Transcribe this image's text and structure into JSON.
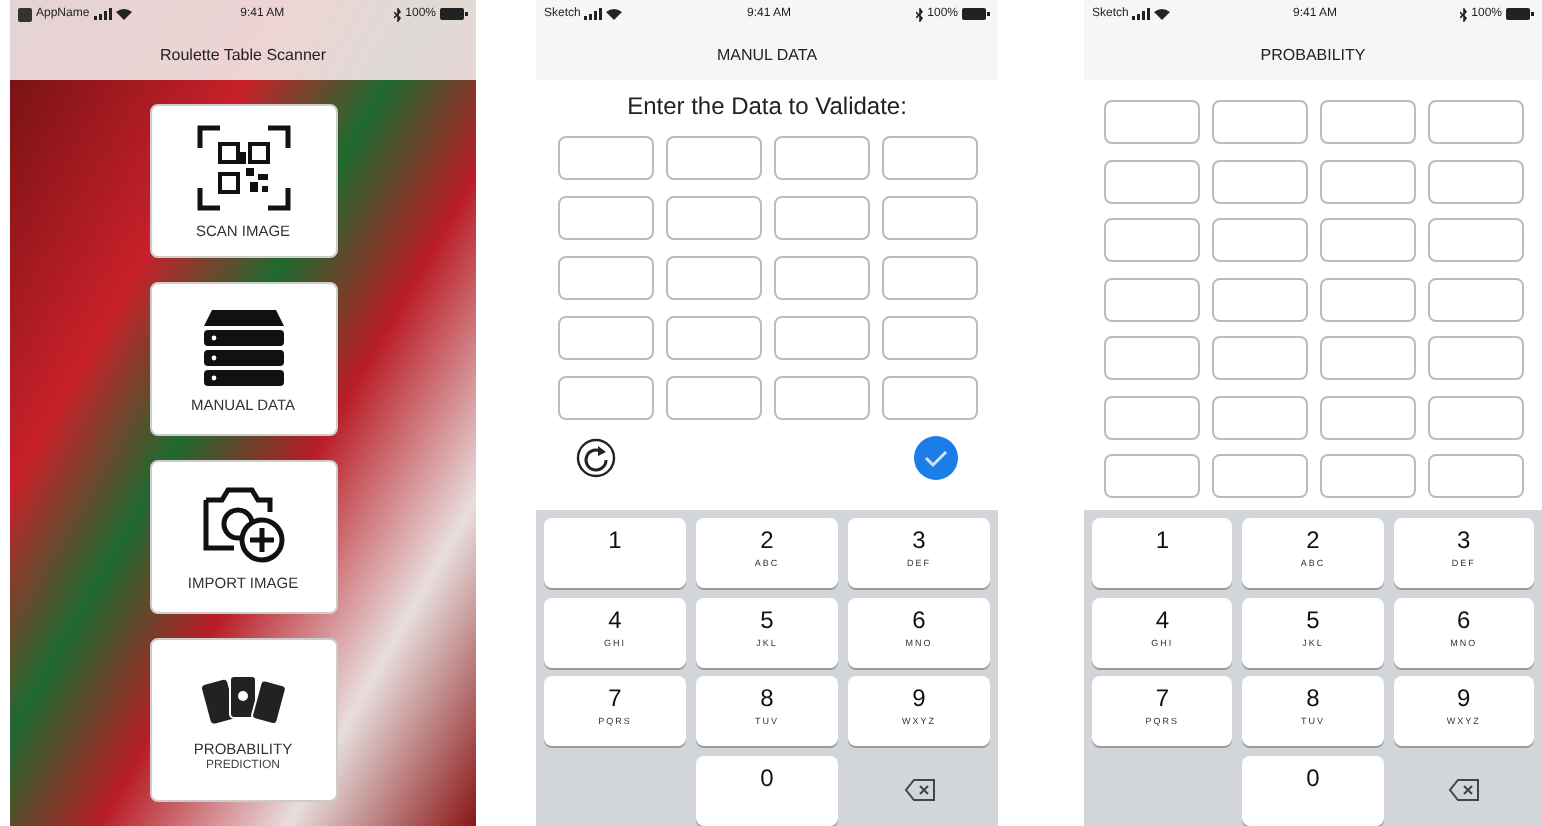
{
  "screens": [
    {
      "kind": "menu",
      "status": {
        "carrier": "AppName",
        "time": "9:41 AM",
        "battery": "100%"
      },
      "title": "Roulette Table Scanner",
      "buttons": [
        {
          "kind": "scan",
          "label": "SCAN IMAGE"
        },
        {
          "kind": "manual",
          "label": "MANUAL DATA"
        },
        {
          "kind": "import",
          "label": "IMPORT IMAGE"
        },
        {
          "kind": "cards",
          "label": "PROBABILITY",
          "sublabel": "PREDICTION"
        }
      ]
    },
    {
      "kind": "entry",
      "status": {
        "carrier": "Sketch",
        "time": "9:41 AM",
        "battery": "100%"
      },
      "title": "MANUL DATA",
      "heading": "Enter the Data to Validate:",
      "keys": [
        {
          "kind": "digit",
          "digit": "1"
        },
        {
          "kind": "digit",
          "digit": "2",
          "letters": "ABC"
        },
        {
          "kind": "digit",
          "digit": "3",
          "letters": "DEF"
        },
        {
          "kind": "digit",
          "digit": "4",
          "letters": "GHI"
        },
        {
          "kind": "digit",
          "digit": "5",
          "letters": "JKL"
        },
        {
          "kind": "digit",
          "digit": "6",
          "letters": "MNO"
        },
        {
          "kind": "digit",
          "digit": "7",
          "letters": "PQRS"
        },
        {
          "kind": "digit",
          "digit": "8",
          "letters": "TUV"
        },
        {
          "kind": "digit",
          "digit": "9",
          "letters": "WXYZ"
        },
        {
          "kind": "blank"
        },
        {
          "kind": "digit",
          "digit": "0"
        },
        {
          "kind": "delete"
        }
      ]
    },
    {
      "kind": "probability",
      "status": {
        "carrier": "Sketch",
        "time": "9:41 AM",
        "battery": "100%"
      },
      "title": "PROBABILITY",
      "keys": [
        {
          "kind": "digit",
          "digit": "1"
        },
        {
          "kind": "digit",
          "digit": "2",
          "letters": "ABC"
        },
        {
          "kind": "digit",
          "digit": "3",
          "letters": "DEF"
        },
        {
          "kind": "digit",
          "digit": "4",
          "letters": "GHI"
        },
        {
          "kind": "digit",
          "digit": "5",
          "letters": "JKL"
        },
        {
          "kind": "digit",
          "digit": "6",
          "letters": "MNO"
        },
        {
          "kind": "digit",
          "digit": "7",
          "letters": "PQRS"
        },
        {
          "kind": "digit",
          "digit": "8",
          "letters": "TUV"
        },
        {
          "kind": "digit",
          "digit": "9",
          "letters": "WXYZ"
        },
        {
          "kind": "blank"
        },
        {
          "kind": "digit",
          "digit": "0"
        },
        {
          "kind": "delete"
        }
      ]
    }
  ]
}
